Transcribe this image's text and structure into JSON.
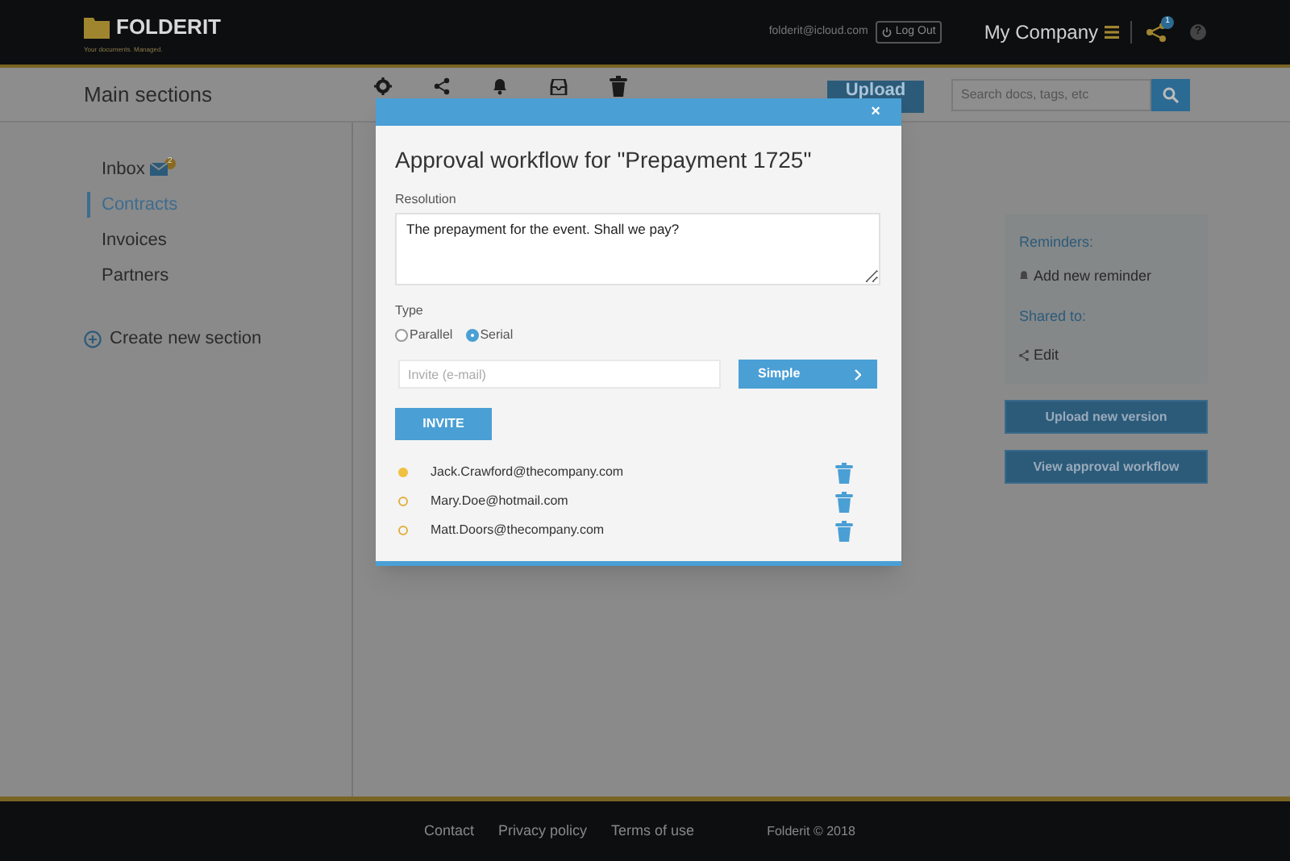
{
  "header": {
    "logo": "FOLDERIT",
    "tagline": "Your documents. Managed.",
    "email": "folderit@icloud.com",
    "logout": "Log Out",
    "company": "My Company",
    "share_badge": "1",
    "help": "?"
  },
  "toolbar": {
    "title": "Main sections",
    "upload": "Upload",
    "search_placeholder": "Search docs, tags, etc"
  },
  "sidebar": {
    "items": [
      {
        "label": "Inbox",
        "selected": false,
        "badge": "2"
      },
      {
        "label": "Contracts",
        "selected": true
      },
      {
        "label": "Invoices",
        "selected": false
      },
      {
        "label": "Partners",
        "selected": false
      }
    ],
    "create": "Create new section"
  },
  "right_panel": {
    "reminders_title": "Reminders:",
    "add_reminder": "Add new reminder",
    "shared_title": "Shared to:",
    "edit": "Edit",
    "buttons": [
      "Upload new version",
      "View approval workflow"
    ]
  },
  "dialog": {
    "close": "×",
    "title": "Approval workflow for \"Prepayment 1725\"",
    "resolution_label": "Resolution",
    "resolution": "The prepayment for the event. Shall we pay?",
    "type_label": "Type",
    "types": [
      {
        "label": "Parallel",
        "selected": false
      },
      {
        "label": "Serial",
        "selected": true
      }
    ],
    "invite_placeholder": "Invite (e-mail)",
    "mode": "Simple",
    "invite": "INVITE",
    "invitees": [
      {
        "email": "Jack.Crawford@thecompany.com",
        "approved": true
      },
      {
        "email": "Mary.Doe@hotmail.com",
        "approved": false
      },
      {
        "email": "Matt.Doors@thecompany.com",
        "approved": false
      }
    ]
  },
  "footer": {
    "links": [
      "Contact",
      "Privacy policy",
      "Terms of use"
    ],
    "copyright": "Folderit © 2018"
  }
}
